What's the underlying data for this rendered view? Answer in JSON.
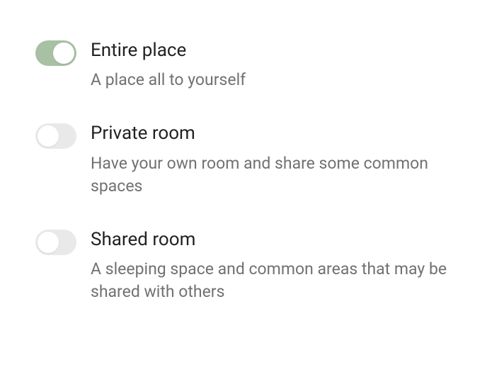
{
  "options": [
    {
      "id": "entire-place",
      "title": "Entire place",
      "description": "A place all to yourself",
      "on": true
    },
    {
      "id": "private-room",
      "title": "Private room",
      "description": "Have your own room and share some common spaces",
      "on": false
    },
    {
      "id": "shared-room",
      "title": "Shared room",
      "description": "A sleeping space and common areas that may be shared with others",
      "on": false
    }
  ],
  "colors": {
    "toggle_on": "#a8c0a3",
    "toggle_off": "#e9e9e9",
    "text_primary": "#222222",
    "text_secondary": "#717171"
  }
}
